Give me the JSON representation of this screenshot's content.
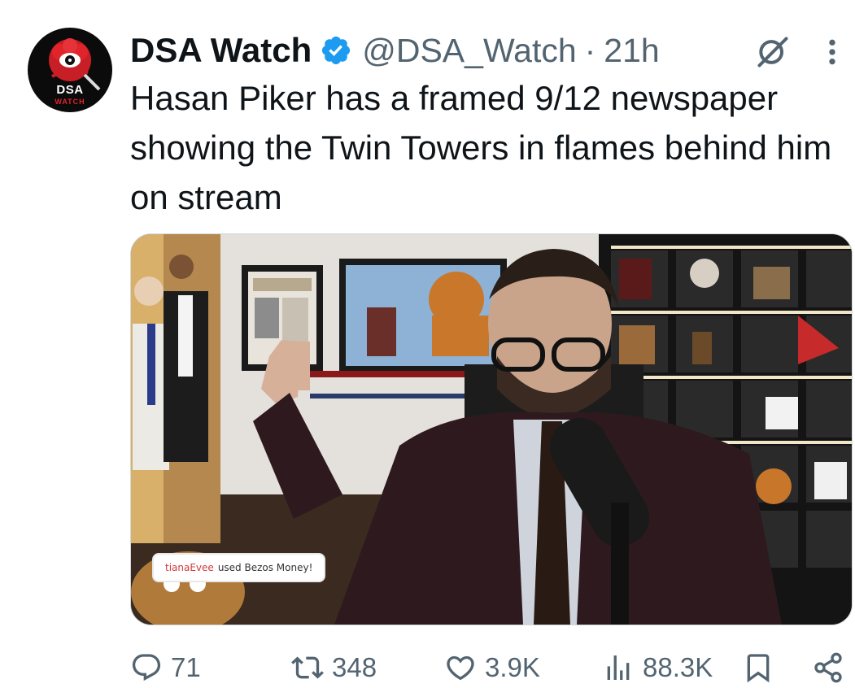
{
  "author": {
    "avatar_text": "DSA",
    "avatar_subtext": "WATCH",
    "display_name": "DSA Watch",
    "handle": "@DSA_Watch",
    "separator": "·",
    "time": "21h"
  },
  "tweet": {
    "text": "Hasan Piker has a framed 9/12 newspaper showing the Twin Towers in flames behind him on stream"
  },
  "media": {
    "chat_user": "tianaEvee",
    "chat_message": "used Bezos Money!"
  },
  "actions": {
    "replies": "71",
    "reposts": "348",
    "likes": "3.9K",
    "views": "88.3K"
  },
  "colors": {
    "verified": "#1d9bf0",
    "text": "#0f1419",
    "secondary": "#536471"
  },
  "icons": [
    "verified-badge-icon",
    "grok-icon",
    "more-icon",
    "reply-icon",
    "repost-icon",
    "like-icon",
    "views-icon",
    "bookmark-icon",
    "share-icon"
  ]
}
